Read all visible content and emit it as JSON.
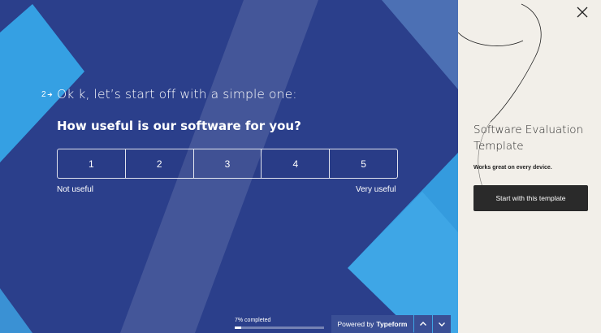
{
  "question": {
    "number": "2",
    "intro": "Ok k, let’s start off with a simple one:",
    "title": "How useful is our software for you?",
    "options": [
      "1",
      "2",
      "3",
      "4",
      "5"
    ],
    "label_low": "Not useful",
    "label_high": "Very useful"
  },
  "progress": {
    "text": "7% completed",
    "fraction": 0.07
  },
  "footer": {
    "powered_by": "Powered by",
    "brand": "Typeform"
  },
  "panel": {
    "title": "Software Evaluation Template",
    "subtitle": "Works great on every device.",
    "cta": "Start with this template"
  },
  "colors": {
    "form_background": "#2b3f8b",
    "accent_light_blue": "#3ea6e6",
    "panel_background": "#f2efe9",
    "cta_background": "#2a2a2a"
  },
  "icons": {
    "question_arrow": "arrow-right-icon",
    "close": "close-icon",
    "up": "chevron-up-icon",
    "down": "chevron-down-icon"
  }
}
